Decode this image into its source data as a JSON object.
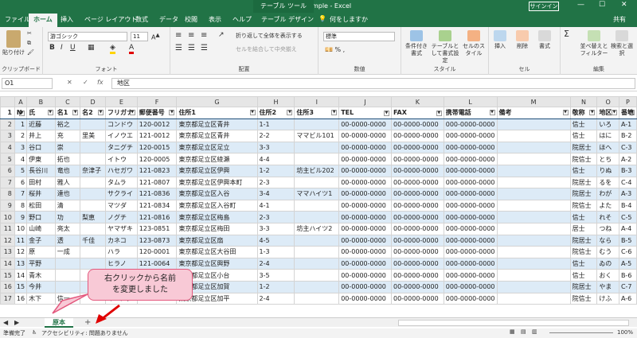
{
  "titlebar": {
    "title": "住所録sample - Excel",
    "context": "テーブル ツール",
    "signin": "サインイン",
    "min": "—",
    "max": "☐",
    "close": "✕"
  },
  "tabs": {
    "file": "ファイル",
    "home": "ホーム",
    "insert": "挿入",
    "layout": "ページ レイアウト",
    "formulas": "数式",
    "data": "データ",
    "review": "校閲",
    "view": "表示",
    "help": "ヘルプ",
    "design": "テーブル デザイン",
    "tell": "何をしますか",
    "share": "共有"
  },
  "ribbon": {
    "paste": "貼り付け",
    "clipboard": "クリップボード",
    "font_name": "游ゴシック",
    "font_size": "11",
    "font_group": "フォント",
    "wrap": "折り返して全体を表示する",
    "merge": "セルを結合して中央揃え",
    "align_group": "配置",
    "numfmt": "標準",
    "number_group": "数値",
    "condfmt": "条件付き書式",
    "tablefmt": "テーブルとして書式設定",
    "cellstyle": "セルのスタイル",
    "style_group": "スタイル",
    "insert": "挿入",
    "delete": "削除",
    "format": "書式",
    "cells_group": "セル",
    "sortfilter": "並べ替えとフィルター",
    "findselect": "検索と選択",
    "edit_group": "編集"
  },
  "formula": {
    "namebox": "O1",
    "value": "地区"
  },
  "columns": [
    "A",
    "B",
    "C",
    "D",
    "E",
    "F",
    "G",
    "H",
    "I",
    "J",
    "K",
    "L",
    "M",
    "N",
    "O",
    "P"
  ],
  "header": [
    "N",
    "氏",
    "名1",
    "名2",
    "フリガナ",
    "郵便番号",
    "住所1",
    "住所2",
    "住所3",
    "TEL",
    "FAX",
    "携帯電話",
    "備考",
    "敬称",
    "地区",
    "番地"
  ],
  "rows": [
    [
      "1",
      "近藤",
      "裕之",
      "",
      "コンドウ",
      "120-0012",
      "東京都足立区青井",
      "1-1",
      "",
      "00-0000-0000",
      "00-0000-0000",
      "000-0000-0000",
      "",
      "信士",
      "いろ",
      "A-1"
    ],
    [
      "2",
      "井上",
      "充",
      "里美",
      "イノウエ",
      "121-0012",
      "東京都足立区青井",
      "2-2",
      "ママビル101",
      "00-0000-0000",
      "00-0000-0000",
      "000-0000-0000",
      "",
      "信士",
      "はに",
      "B-2"
    ],
    [
      "3",
      "谷口",
      "崇",
      "",
      "タニグチ",
      "120-0015",
      "東京都足立区足立",
      "3-3",
      "",
      "00-0000-0000",
      "00-0000-0000",
      "000-0000-0000",
      "",
      "院居士",
      "ほへ",
      "C-3"
    ],
    [
      "4",
      "伊東",
      "拓也",
      "",
      "イトウ",
      "120-0005",
      "東京都足立区綾瀬",
      "4-4",
      "",
      "00-0000-0000",
      "00-0000-0000",
      "000-0000-0000",
      "",
      "院信士",
      "とち",
      "A-2"
    ],
    [
      "5",
      "長谷川",
      "竜也",
      "奈津子",
      "ハセガワ",
      "121-0823",
      "東京都足立区伊興",
      "1-2",
      "坊主ビル202",
      "00-0000-0000",
      "00-0000-0000",
      "000-0000-0000",
      "",
      "信士",
      "りぬ",
      "B-3"
    ],
    [
      "6",
      "田村",
      "雅人",
      "",
      "タムラ",
      "121-0807",
      "東京都足立区伊興本町",
      "2-3",
      "",
      "00-0000-0000",
      "00-0000-0000",
      "000-0000-0000",
      "",
      "院居士",
      "るを",
      "C-4"
    ],
    [
      "7",
      "桜井",
      "達也",
      "",
      "サクライ",
      "121-0836",
      "東京都足立区入谷",
      "3-4",
      "ママハイツ1",
      "00-0000-0000",
      "00-0000-0000",
      "000-0000-0000",
      "",
      "院居士",
      "わが",
      "A-3"
    ],
    [
      "8",
      "松田",
      "清",
      "",
      "マツダ",
      "121-0834",
      "東京都足立区入谷町",
      "4-1",
      "",
      "00-0000-0000",
      "00-0000-0000",
      "000-0000-0000",
      "",
      "院信士",
      "よた",
      "B-4"
    ],
    [
      "9",
      "野口",
      "功",
      "梨恵",
      "ノグチ",
      "121-0816",
      "東京都足立区梅島",
      "2-3",
      "",
      "00-0000-0000",
      "00-0000-0000",
      "000-0000-0000",
      "",
      "信士",
      "れそ",
      "C-5"
    ],
    [
      "10",
      "山崎",
      "亮太",
      "",
      "ヤマザキ",
      "123-0851",
      "東京都足立区梅田",
      "3-3",
      "坊主ハイツ2",
      "00-0000-0000",
      "00-0000-0000",
      "000-0000-0000",
      "",
      "居士",
      "つね",
      "A-4"
    ],
    [
      "11",
      "金子",
      "透",
      "千佳",
      "カネコ",
      "123-0873",
      "東京都足立区扇",
      "4-5",
      "",
      "00-0000-0000",
      "00-0000-0000",
      "000-0000-0000",
      "",
      "院居士",
      "なら",
      "B-5"
    ],
    [
      "12",
      "原",
      "一成",
      "",
      "ハラ",
      "120-0001",
      "東京都足立区大谷田",
      "1-3",
      "",
      "00-0000-0000",
      "00-0000-0000",
      "000-0000-0000",
      "",
      "院信士",
      "むう",
      "C-6"
    ],
    [
      "13",
      "平野",
      "",
      "",
      "ヒラノ",
      "121-0064",
      "東京都足立区興野",
      "2-4",
      "",
      "00-0000-0000",
      "00-0000-0000",
      "000-0000-0000",
      "",
      "信士",
      "ゐの",
      "A-5"
    ],
    [
      "14",
      "青木",
      "",
      "",
      "アオキ",
      "120-0046",
      "東京都足立区小台",
      "3-5",
      "",
      "00-0000-0000",
      "00-0000-0000",
      "000-0000-0000",
      "",
      "信士",
      "おく",
      "B-6"
    ],
    [
      "15",
      "今井",
      "",
      "",
      "イマイ",
      "123-0861",
      "東京都足立区加賀",
      "1-2",
      "",
      "00-0000-0000",
      "00-0000-0000",
      "000-0000-0000",
      "",
      "院居士",
      "やま",
      "C-7"
    ],
    [
      "16",
      "木下",
      "信一",
      "",
      "キノシタ",
      "121-0055",
      "東京都足立区加平",
      "2-4",
      "",
      "00-0000-0000",
      "00-0000-0000",
      "000-0000-0000",
      "",
      "院信士",
      "けふ",
      "A-6"
    ]
  ],
  "sheet": {
    "tab": "原本",
    "add": "+"
  },
  "status": {
    "ready": "準備完了",
    "access": "アクセシビリティ: 問題ありません",
    "zoom": "100%"
  },
  "callout": {
    "line1": "右クリックから名前",
    "line2": "を変更しました"
  }
}
